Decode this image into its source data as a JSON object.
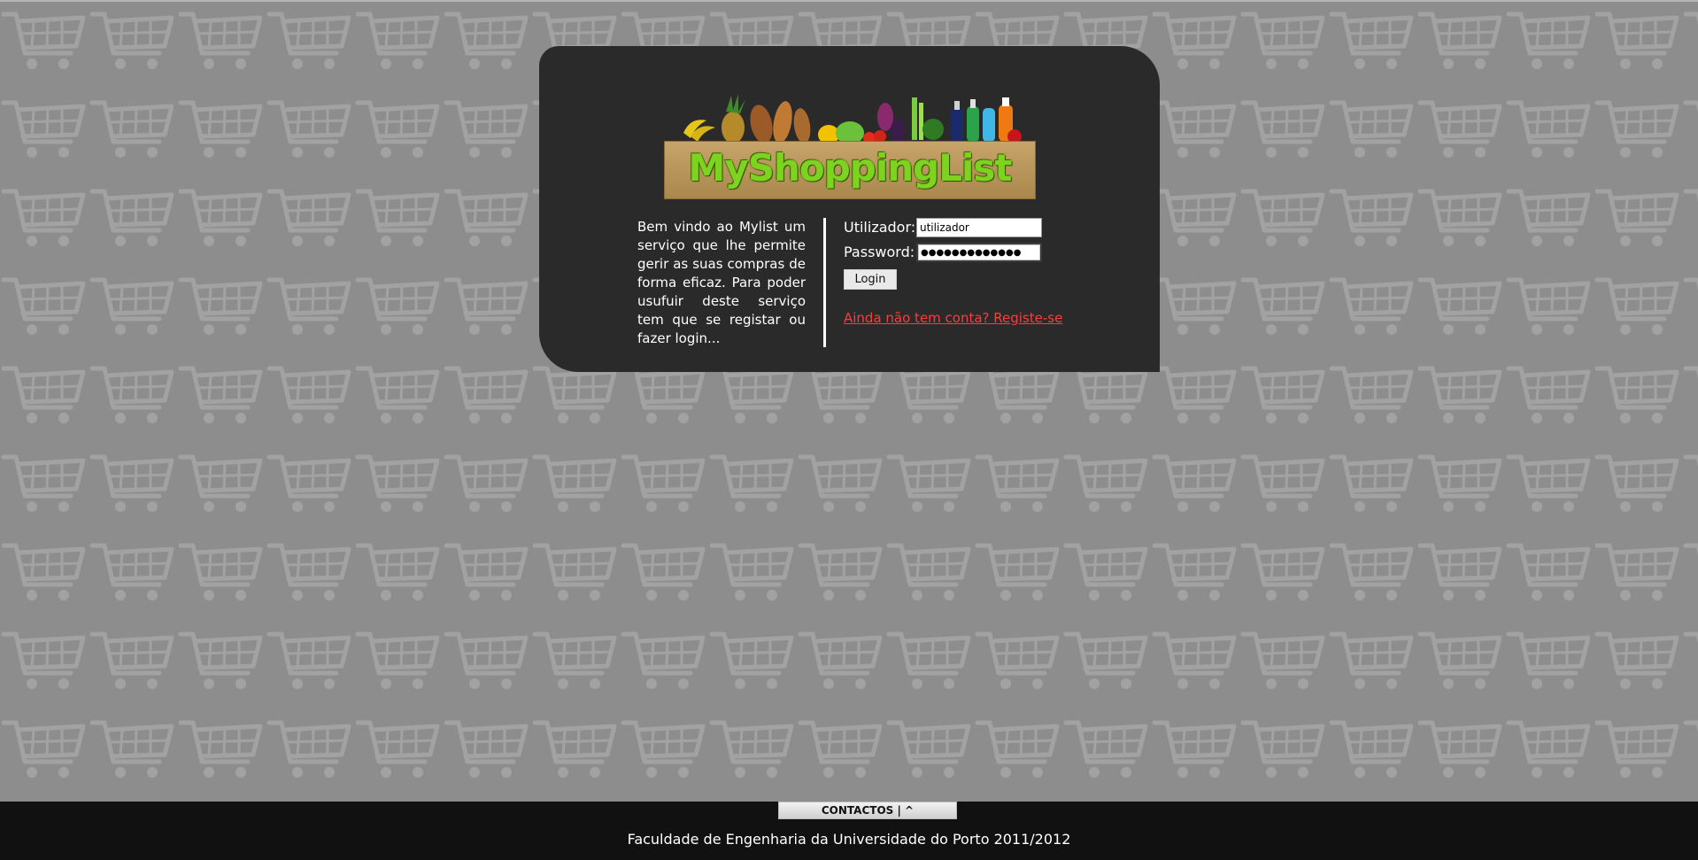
{
  "logo": {
    "text": "MyShoppingList"
  },
  "intro": {
    "text": "Bem vindo ao Mylist um serviço que lhe permite gerir as suas compras de forma eficaz. Para poder usufuir deste serviço tem que se registar ou fazer login..."
  },
  "login_form": {
    "username_label": "Utilizador:",
    "username_value": "utilizador",
    "password_label": "Password:",
    "password_masked": "●●●●●●●●●●●●●",
    "login_button": "Login",
    "register_link": "Ainda não tem conta? Registe-se"
  },
  "footer": {
    "contact_tab": "CONTACTOS | ^",
    "credit": "Faculdade de Engenharia da Universidade do Porto 2011/2012"
  },
  "colors": {
    "panel": "#2a2a2a",
    "register_link": "#ff3b3b",
    "logo_text": "#7ed321",
    "footer": "#111111"
  },
  "icons": {
    "background_pattern": "shopping-cart-icon"
  }
}
